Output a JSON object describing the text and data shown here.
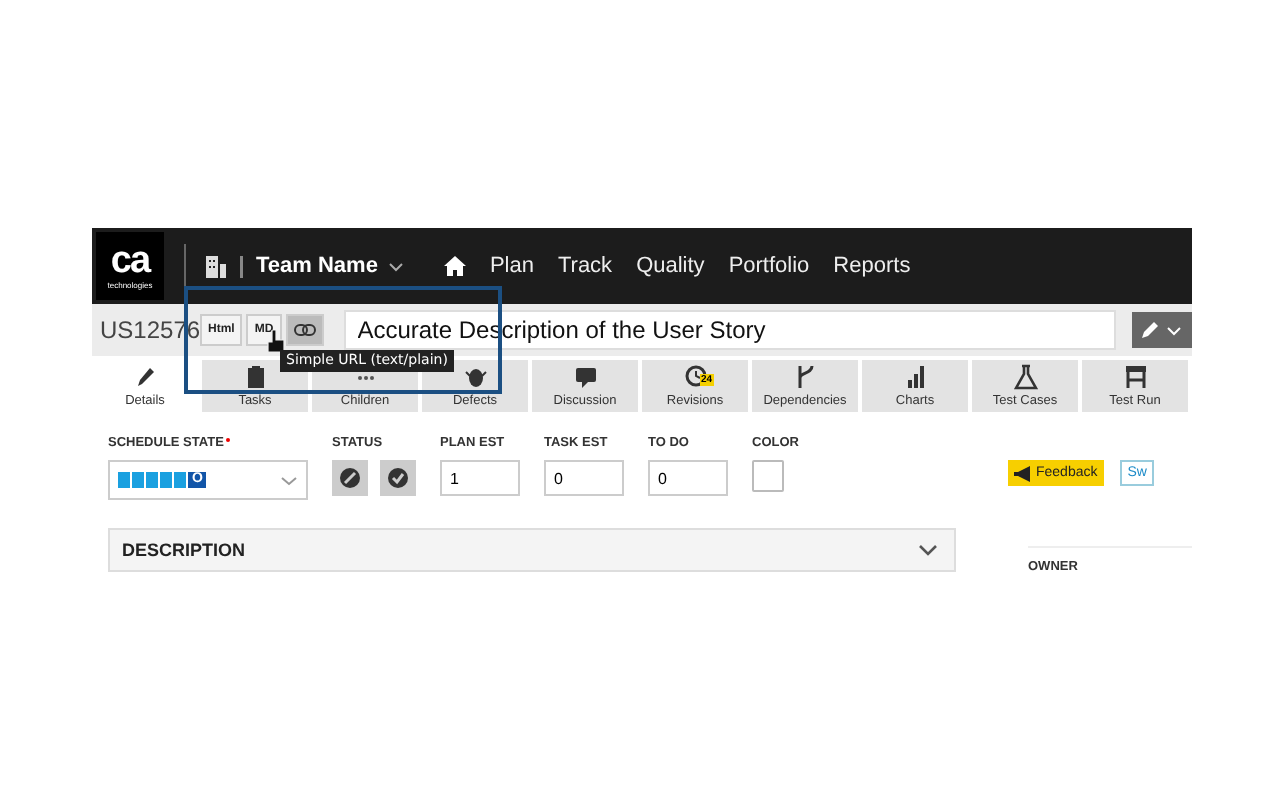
{
  "header": {
    "logo": "ca",
    "logo_sub": "technologies",
    "team": "Team Name",
    "nav": [
      {
        "label": "Plan"
      },
      {
        "label": "Track"
      },
      {
        "label": "Quality"
      },
      {
        "label": "Portfolio"
      },
      {
        "label": "Reports"
      }
    ]
  },
  "story": {
    "id": "US12576",
    "formats": [
      {
        "kind": "text",
        "label": "Html"
      },
      {
        "kind": "text",
        "label": "MD"
      },
      {
        "kind": "link"
      }
    ],
    "title": "Accurate Description of the User Story"
  },
  "tooltip": "Simple URL (text/plain)",
  "tabs": [
    {
      "label": "Details",
      "kind": "pencil",
      "selected": true
    },
    {
      "label": "Tasks",
      "kind": "clipboard",
      "selected": false
    },
    {
      "label": "Children",
      "kind": "dots",
      "selected": false
    },
    {
      "label": "Defects",
      "kind": "bug",
      "selected": false
    },
    {
      "label": "Discussion",
      "kind": "chat",
      "selected": false
    },
    {
      "label": "Revisions",
      "kind": "history",
      "badge": "24",
      "selected": false
    },
    {
      "label": "Dependencies",
      "kind": "branch",
      "selected": false
    },
    {
      "label": "Charts",
      "kind": "bars",
      "selected": false
    },
    {
      "label": "Test Cases",
      "kind": "flask",
      "selected": false
    },
    {
      "label": "Test Run",
      "kind": "bench",
      "selected": false
    }
  ],
  "fields": {
    "schedule_state": {
      "label": "SCHEDULE STATE",
      "required": true,
      "segments": [
        {
          "done": true
        },
        {
          "done": true
        },
        {
          "done": true
        },
        {
          "done": true
        },
        {
          "done": true
        }
      ],
      "current": "O"
    },
    "status": {
      "label": "STATUS",
      "buttons": [
        {
          "kind": "blocked"
        },
        {
          "kind": "ready"
        }
      ]
    },
    "numbers": [
      {
        "label": "PLAN EST",
        "value": "1"
      },
      {
        "label": "TASK EST",
        "value": "0"
      },
      {
        "label": "TO DO",
        "value": "0"
      }
    ],
    "color": {
      "label": "COLOR"
    }
  },
  "actions": [
    {
      "kind": "feedback",
      "label": "Feedback"
    },
    {
      "kind": "outline",
      "label": "Sw"
    }
  ],
  "description": {
    "title": "DESCRIPTION"
  },
  "owner": {
    "label": "OWNER"
  }
}
